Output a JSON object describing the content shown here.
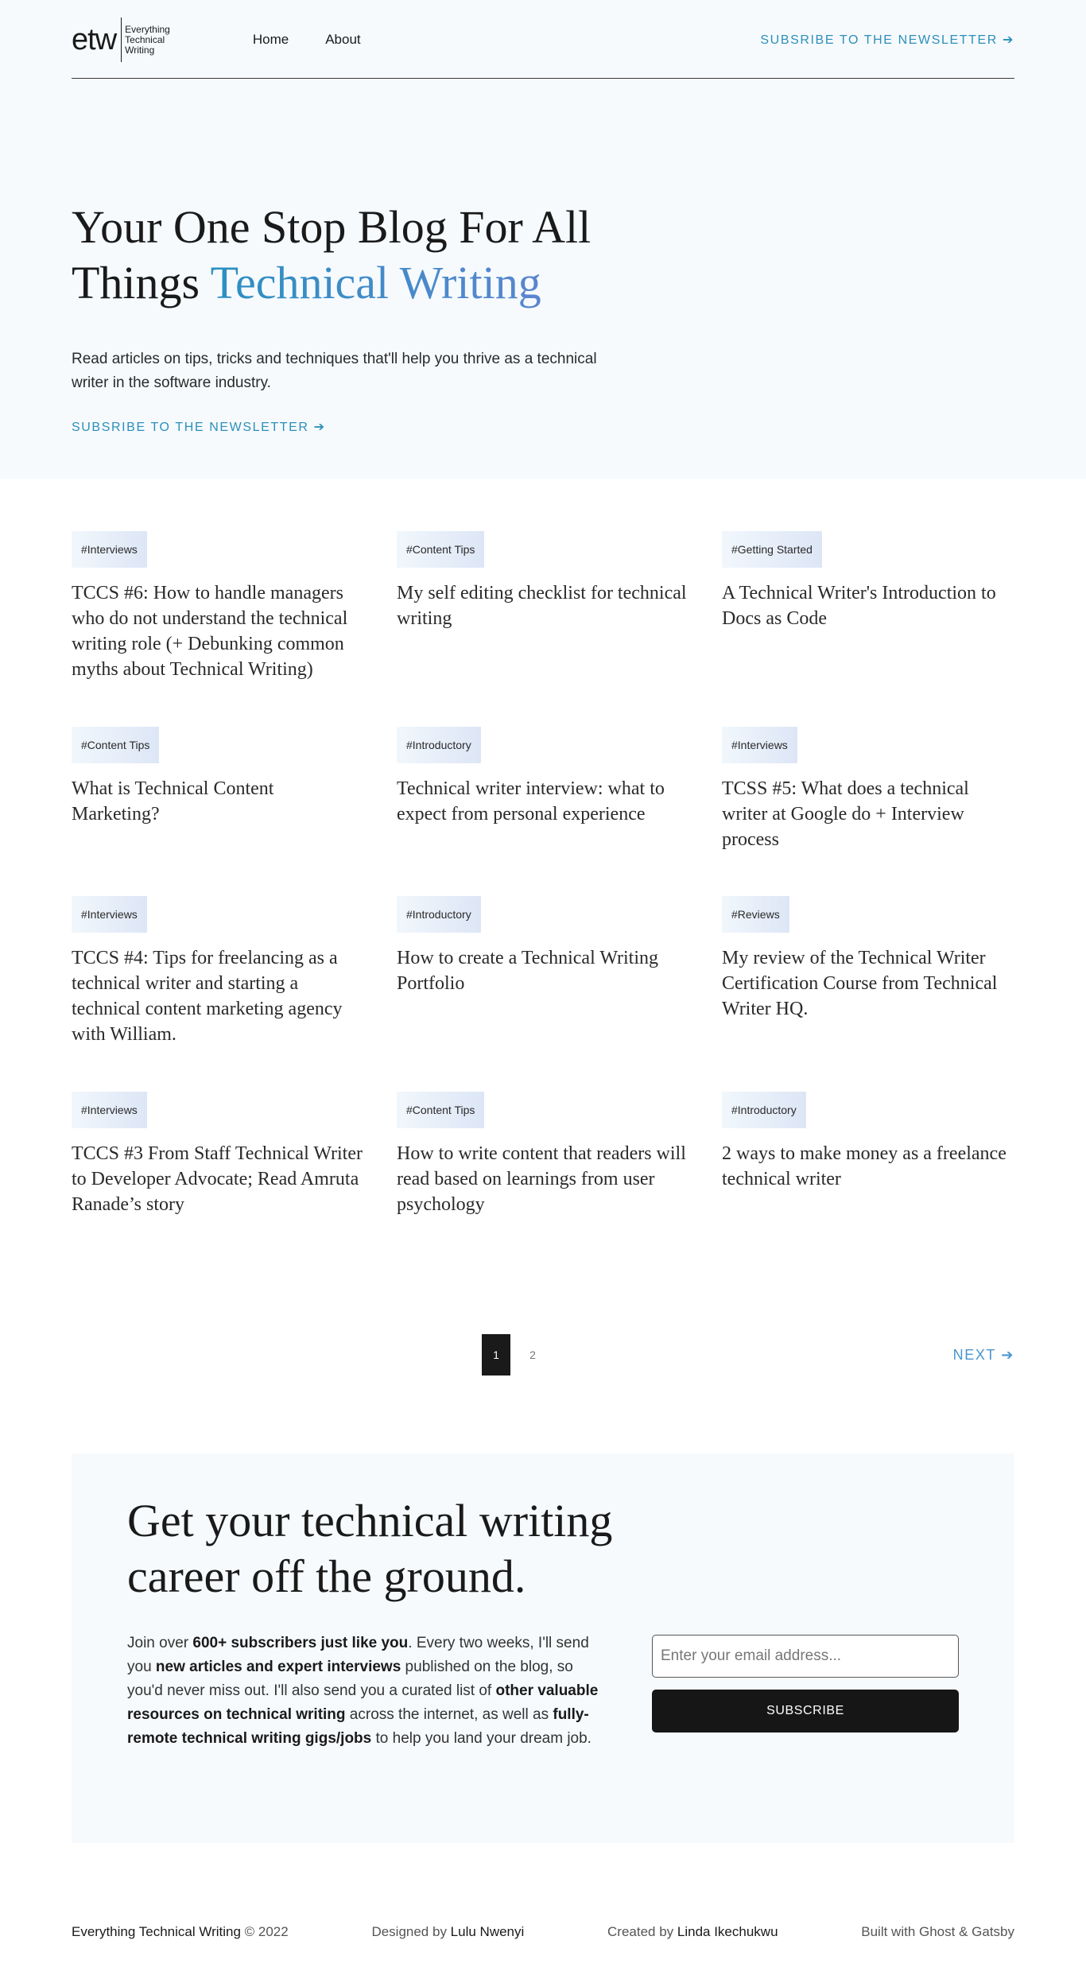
{
  "header": {
    "logo_mark": "etw",
    "logo_lines": [
      "Everything",
      "Technical",
      "Writing"
    ],
    "nav": [
      "Home",
      "About"
    ],
    "newsletter_link": "SUBSRIBE TO THE NEWSLETTER ➔"
  },
  "hero": {
    "title_plain": "Your One Stop Blog For All Things",
    "title_accent": "Technical Writing",
    "description": "Read articles on tips, tricks and techniques that'll help you thrive as a technical writer in the software industry.",
    "cta": "SUBSRIBE TO THE NEWSLETTER ➔",
    "accent_colors": [
      "#2b8fc1",
      "#5a86cf"
    ]
  },
  "posts": [
    {
      "tag": "#Interviews",
      "title": "TCCS #6: How to handle managers who do not understand the technical writing role (+ Debunking common myths about Technical Writing)"
    },
    {
      "tag": "#Content Tips",
      "title": "My self editing checklist for technical writing"
    },
    {
      "tag": "#Getting Started",
      "title": "A Technical Writer's Introduction to Docs as Code"
    },
    {
      "tag": "#Content Tips",
      "title": "What is Technical Content Marketing?"
    },
    {
      "tag": "#Introductory",
      "title": "Technical writer interview: what to expect from personal experience"
    },
    {
      "tag": "#Interviews",
      "title": "TCSS #5: What does a technical writer at Google do + Interview process"
    },
    {
      "tag": "#Interviews",
      "title": "TCCS #4: Tips for freelancing as a technical writer and starting a technical content marketing agency with William."
    },
    {
      "tag": "#Introductory",
      "title": "How to create a Technical Writing Portfolio"
    },
    {
      "tag": "#Reviews",
      "title": "My review of the Technical Writer Certification Course from Technical Writer HQ."
    },
    {
      "tag": "#Interviews",
      "title": "TCCS #3 From Staff Technical Writer to Developer Advocate; Read Amruta Ranade’s story"
    },
    {
      "tag": "#Content Tips",
      "title": "How to write content that readers will read based on learnings from user psychology"
    },
    {
      "tag": "#Introductory",
      "title": "2 ways to make money as a freelance technical writer"
    }
  ],
  "pagination": {
    "pages": [
      "1",
      "2"
    ],
    "current": "1",
    "next_label": "NEXT ➔"
  },
  "signup": {
    "title": "Get your technical writing career off the ground.",
    "copy": [
      {
        "text": "Join over ",
        "bold": false
      },
      {
        "text": "600+ subscribers just like you",
        "bold": true
      },
      {
        "text": ". Every two weeks, I'll send you ",
        "bold": false
      },
      {
        "text": "new articles and expert interviews",
        "bold": true
      },
      {
        "text": " published on the blog, so you'd never miss out. I'll also send you a curated list of ",
        "bold": false
      },
      {
        "text": "other valuable resources on technical writing",
        "bold": true
      },
      {
        "text": " across the internet, as well as ",
        "bold": false
      },
      {
        "text": "fully-remote technical writing gigs/jobs",
        "bold": true
      },
      {
        "text": " to help you land your dream job.",
        "bold": false
      }
    ],
    "email_placeholder": "Enter your email address...",
    "email_value": "",
    "button_label": "SUBSCRIBE"
  },
  "footer": {
    "site": "Everything Technical Writing",
    "copyright": " © 2022",
    "designed_prefix": "Designed by ",
    "designer": "Lulu Nwenyi",
    "created_prefix": "Created by ",
    "creator": "Linda Ikechukwu",
    "built_with": "Built with Ghost & Gatsby"
  }
}
